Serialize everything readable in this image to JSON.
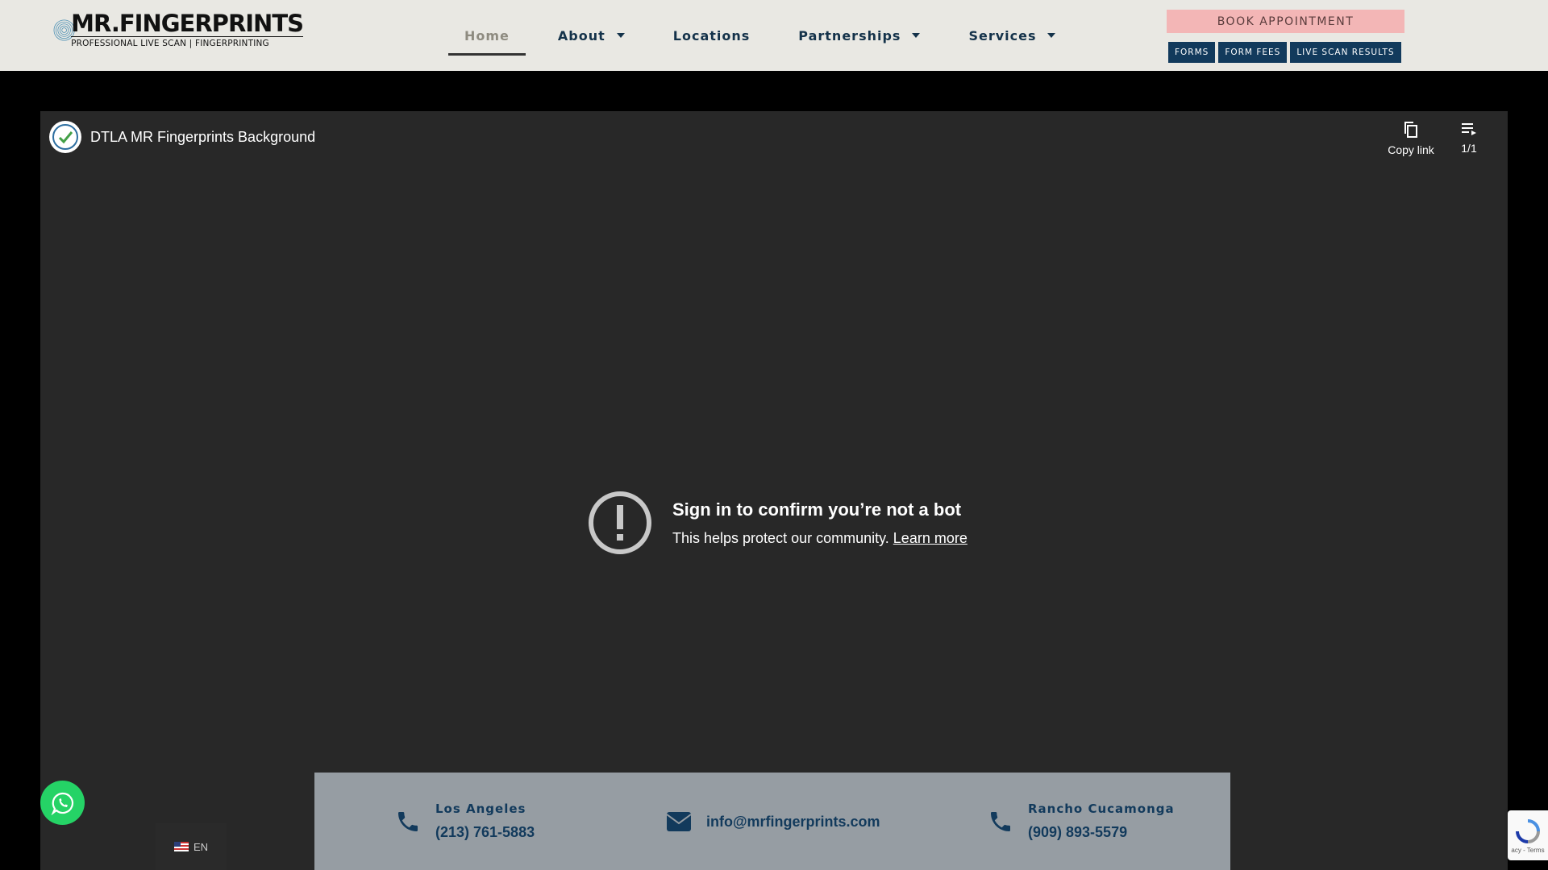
{
  "header": {
    "logo": {
      "title": "MR.FINGERPRINTS",
      "subtitle": "PROFESSIONAL LIVE SCAN | FINGERPRINTING"
    },
    "nav": [
      {
        "label": "Home",
        "active": true,
        "dropdown": false
      },
      {
        "label": "About",
        "active": false,
        "dropdown": true
      },
      {
        "label": "Locations",
        "active": false,
        "dropdown": false
      },
      {
        "label": "Partnerships",
        "active": false,
        "dropdown": true
      },
      {
        "label": "Services",
        "active": false,
        "dropdown": true
      }
    ],
    "book_label": "BOOK APPOINTMENT",
    "small_buttons": [
      "FORMS",
      "FORM FEES",
      "LIVE SCAN RESULTS"
    ]
  },
  "player": {
    "title": "DTLA MR Fingerprints Background",
    "copy_label": "Copy link",
    "playlist_count": "1/1",
    "error_heading": "Sign in to confirm you’re not a bot",
    "error_text": "This helps protect our community.",
    "learn_more": "Learn more"
  },
  "contact": {
    "la": {
      "label": "Los Angeles",
      "phone": "(213) 761-5883"
    },
    "email": "info@mrfingerprints.com",
    "rc": {
      "label": "Rancho Cucamonga",
      "phone": "(909) 893-5579"
    }
  },
  "lang": {
    "code": "EN"
  },
  "recaptcha": {
    "footer": "acy - Terms"
  },
  "colors": {
    "navy": "#123a5c",
    "book_pink": "#f3b6b6",
    "whatsapp": "#25d366",
    "player_bg": "#282828"
  }
}
